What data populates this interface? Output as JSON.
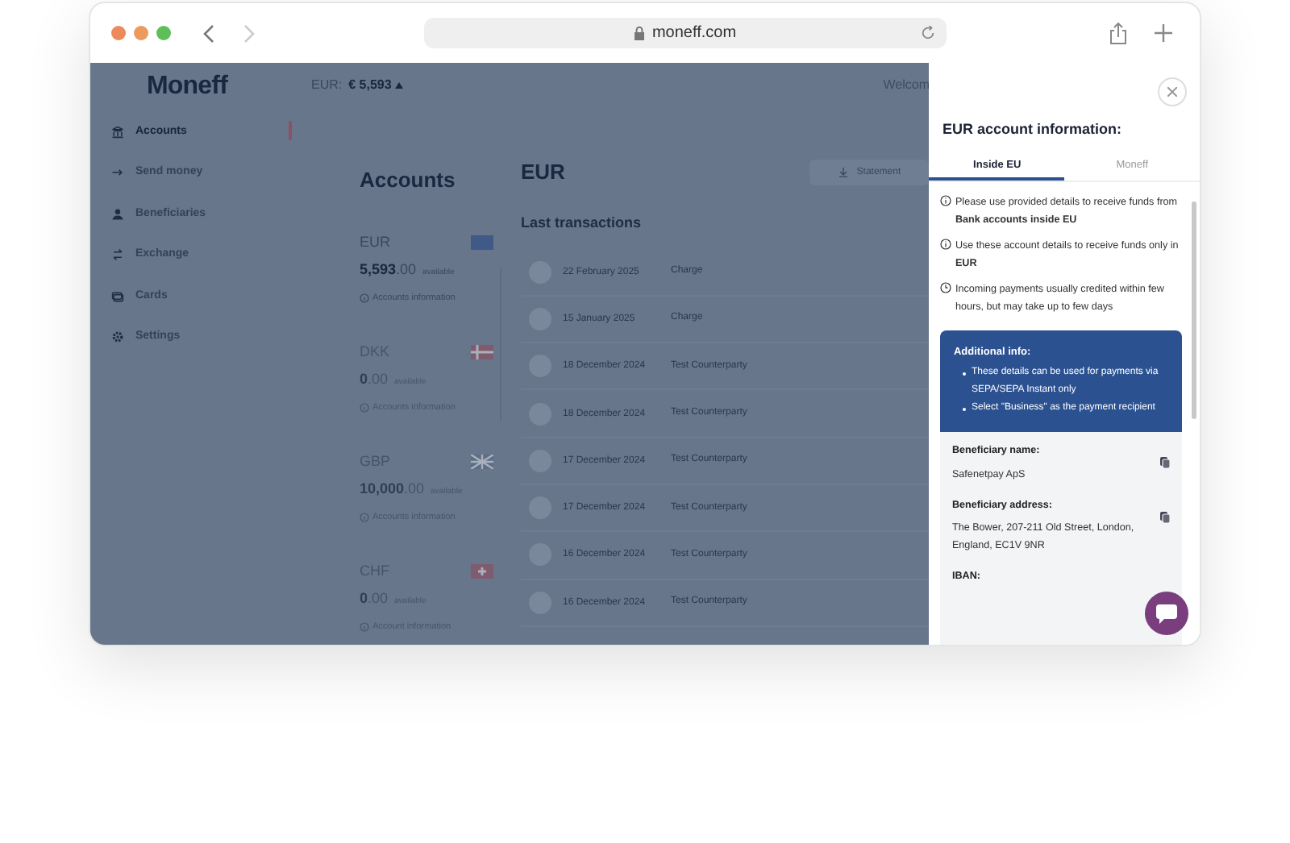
{
  "browser": {
    "url": "moneff.com"
  },
  "app": {
    "logo": "Moneff",
    "balance_label": "EUR:",
    "balance": "€ 5,593",
    "welcome": "Welcom",
    "sidebar": {
      "items": [
        {
          "label": "Accounts",
          "kind": "accounts",
          "selected": true
        },
        {
          "label": "Send money",
          "kind": "send",
          "selected": false
        },
        {
          "label": "Beneficiaries",
          "kind": "people",
          "selected": false
        },
        {
          "label": "Exchange",
          "kind": "exchange",
          "selected": false
        },
        {
          "label": "Cards",
          "kind": "cards",
          "selected": false
        },
        {
          "label": "Settings",
          "kind": "settings",
          "selected": false
        }
      ]
    },
    "accounts": {
      "title": "Accounts",
      "items": [
        {
          "currency": "EUR",
          "amount": "5,593",
          "decimals": ".00",
          "available": "available",
          "info": "Accounts information",
          "kind": "eu",
          "selected": true
        },
        {
          "currency": "DKK",
          "amount": "0",
          "decimals": ".00",
          "available": "available",
          "info": "Accounts information",
          "kind": "dk",
          "selected": false
        },
        {
          "currency": "GBP",
          "amount": "10,000",
          "decimals": ".00",
          "available": "available",
          "info": "Accounts information",
          "kind": "gb",
          "selected": false
        },
        {
          "currency": "CHF",
          "amount": "0",
          "decimals": ".00",
          "available": "available",
          "info": "Account information",
          "kind": "ch",
          "selected": false
        }
      ]
    },
    "detail": {
      "title": "EUR",
      "statement_button": "Statement",
      "transactions_title": "Last transactions",
      "transactions": [
        {
          "date": "22 February 2025",
          "description": "Charge"
        },
        {
          "date": "15 January 2025",
          "description": "Charge"
        },
        {
          "date": "18 December 2024",
          "description": "Test Counterparty"
        },
        {
          "date": "18 December 2024",
          "description": "Test Counterparty"
        },
        {
          "date": "17 December 2024",
          "description": "Test Counterparty"
        },
        {
          "date": "17 December 2024",
          "description": "Test Counterparty"
        },
        {
          "date": "16 December 2024",
          "description": "Test Counterparty"
        },
        {
          "date": "16 December 2024",
          "description": "Test Counterparty"
        }
      ]
    }
  },
  "panel": {
    "title": "EUR account information:",
    "tabs": [
      {
        "label": "Inside EU",
        "selected": true
      },
      {
        "label": "Moneff",
        "selected": false
      }
    ],
    "notes": [
      {
        "kind": "info",
        "text": "Please use provided details to receive funds from **Bank accounts inside EU**"
      },
      {
        "kind": "info",
        "text": "Use these account details to receive funds only in **EUR**"
      },
      {
        "kind": "clock",
        "text": "Incoming payments usually credited within few hours, but may take up to few days"
      }
    ],
    "additional": {
      "title": "Additional info:",
      "bullets": [
        "These details can be used for payments via SEPA/SEPA Instant only",
        "Select \"Business\" as the payment recipient"
      ]
    },
    "fields": [
      {
        "label": "Beneficiary name:",
        "value": "Safenetpay ApS"
      },
      {
        "label": "Beneficiary address:",
        "value": "The Bower, 207-211 Old Street, London, England, EC1V 9NR"
      },
      {
        "label": "IBAN:"
      }
    ]
  }
}
